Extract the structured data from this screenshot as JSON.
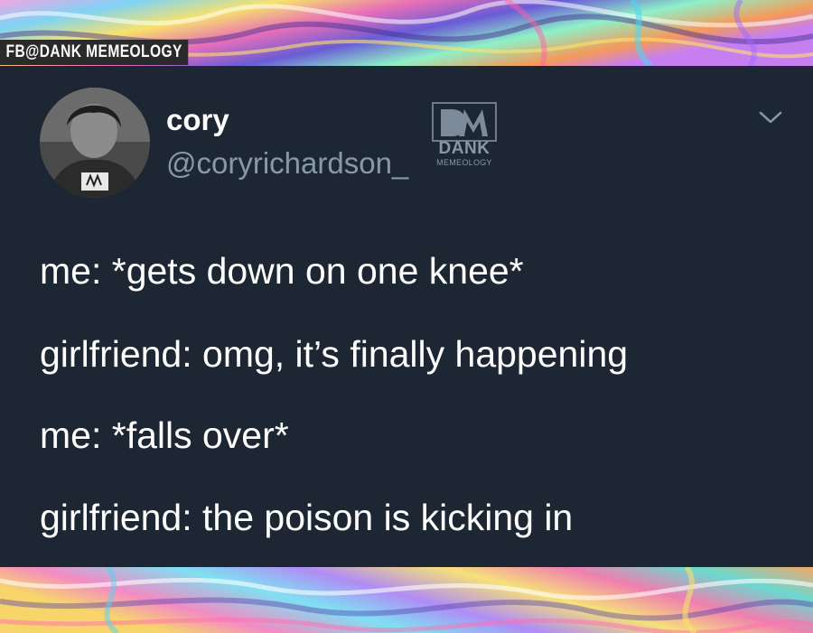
{
  "watermark": {
    "label": "FB@DANK MEMEOLOGY"
  },
  "tweet": {
    "display_name": "cory",
    "handle": "@coryrichardson_",
    "logo": {
      "icon": "dank-memeology-dm-logo",
      "word": "DANK",
      "sub": "MEMEOLOGY"
    },
    "menu_icon": "chevron-down-icon",
    "lines": [
      "me: *gets down on one knee*",
      "girlfriend: omg, it’s finally happening",
      "me: *falls over*",
      "girlfriend: the poison is kicking in"
    ]
  },
  "colors": {
    "background": "#1c2733",
    "name": "#ffffff",
    "handle": "#8899a6",
    "text": "#ffffff"
  }
}
